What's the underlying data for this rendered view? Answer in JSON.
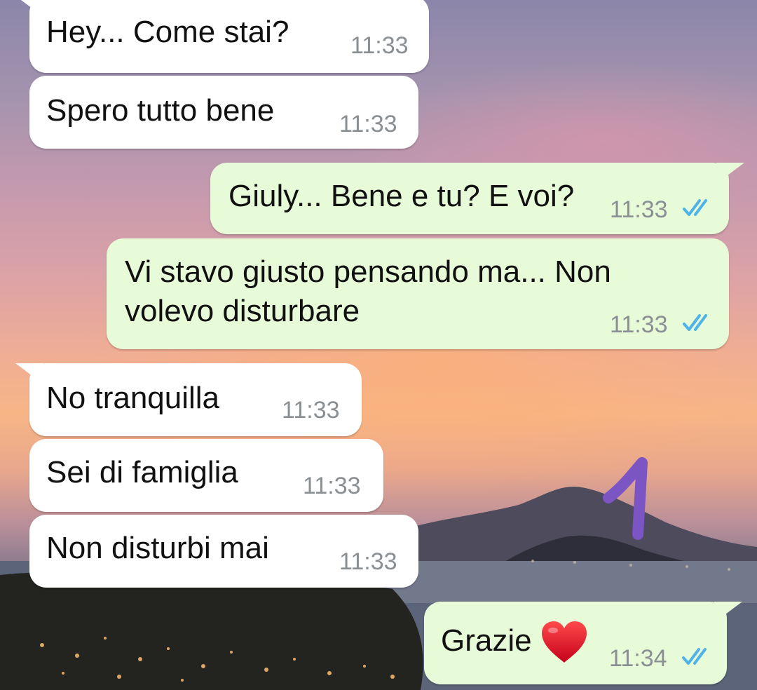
{
  "messages": [
    {
      "direction": "incoming",
      "text": "Hey... Come stai?",
      "time": "11:33"
    },
    {
      "direction": "incoming",
      "text": "Spero tutto bene",
      "time": "11:33"
    },
    {
      "direction": "outgoing",
      "text": "Giuly... Bene e tu? E voi?",
      "time": "11:33",
      "status": "read"
    },
    {
      "direction": "outgoing",
      "lines": [
        "Vi stavo giusto pensando ma... Non",
        "volevo disturbare"
      ],
      "time": "11:33",
      "status": "read"
    },
    {
      "direction": "incoming",
      "text": "No tranquilla",
      "time": "11:33"
    },
    {
      "direction": "incoming",
      "text": "Sei di famiglia",
      "time": "11:33"
    },
    {
      "direction": "incoming",
      "text": "Non disturbi mai",
      "time": "11:33"
    },
    {
      "direction": "outgoing",
      "text": "Grazie",
      "emoji": "red-heart",
      "time": "11:34",
      "status": "read"
    }
  ],
  "annotation": {
    "text": "1",
    "color": "#7b55c4"
  },
  "colors": {
    "incoming_bubble": "#ffffff",
    "outgoing_bubble": "#e7fbd9",
    "read_ticks": "#4fb3e8"
  }
}
